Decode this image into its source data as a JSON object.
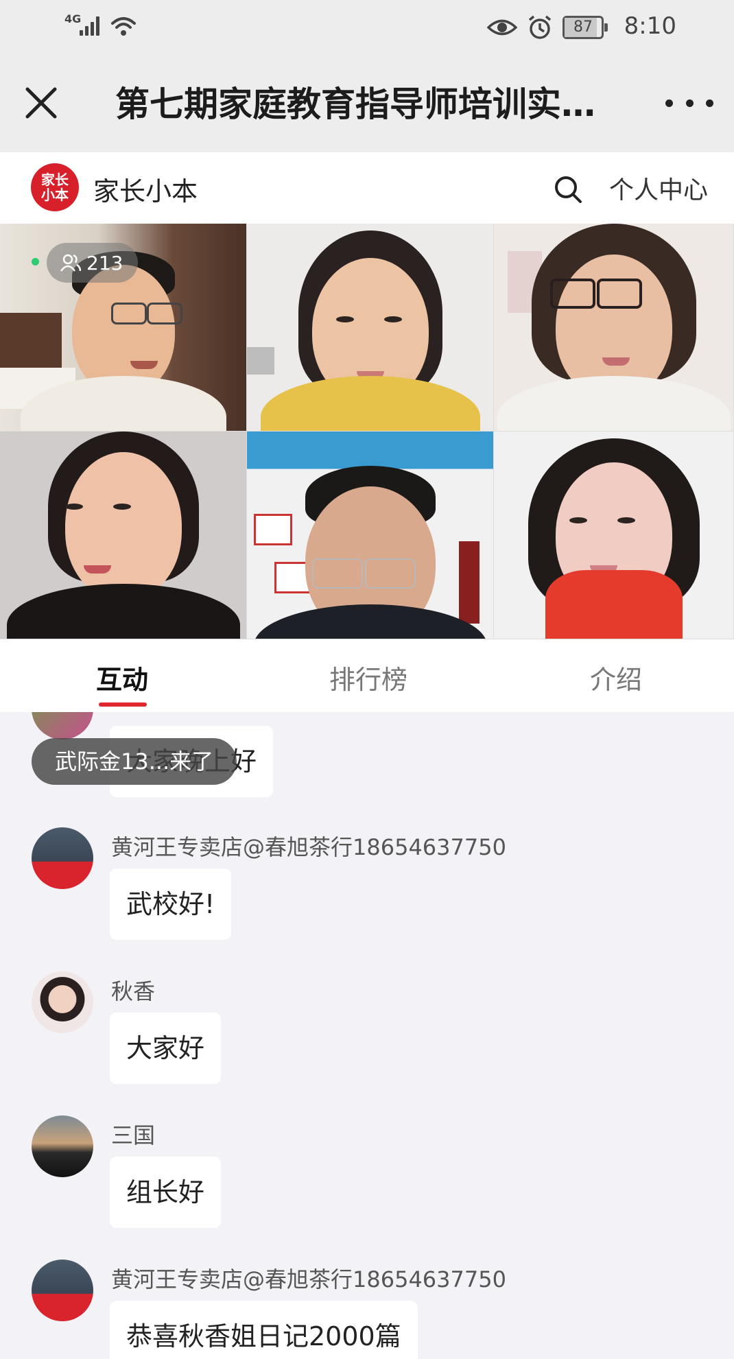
{
  "status_bar": {
    "network": "4G",
    "battery": "87",
    "battery_level": 0.87,
    "time": "8:10",
    "icons": [
      "signal-icon",
      "wifi-icon",
      "eye-icon",
      "alarm-icon",
      "battery-icon"
    ]
  },
  "header": {
    "title": "第七期家庭教育指导师培训实…",
    "close_icon": "close-icon",
    "more_icon": "more-icon"
  },
  "brand": {
    "logo_text": "家长小本",
    "name": "家长小本",
    "profile_label": "个人中心",
    "search_icon": "search-icon"
  },
  "live": {
    "viewer_count": "213",
    "tiles": 6
  },
  "tabs": [
    {
      "label": "互动",
      "active": true
    },
    {
      "label": "排行榜",
      "active": false
    },
    {
      "label": "介绍",
      "active": false
    }
  ],
  "chat": {
    "join_notice": "武际金13...来了",
    "partial_message": "大家晚上好",
    "messages": [
      {
        "user": "黄河王专卖店@春旭茶行18654637750",
        "text": "武校好!"
      },
      {
        "user": "秋香",
        "text": "大家好"
      },
      {
        "user": "三国",
        "text": "组长好"
      },
      {
        "user": "黄河王专卖店@春旭茶行18654637750",
        "text": "恭喜秋香姐日记2000篇"
      }
    ]
  },
  "colors": {
    "accent": "#e0262f",
    "brand_red": "#d8202a",
    "chat_bg": "#f3f3f7"
  }
}
